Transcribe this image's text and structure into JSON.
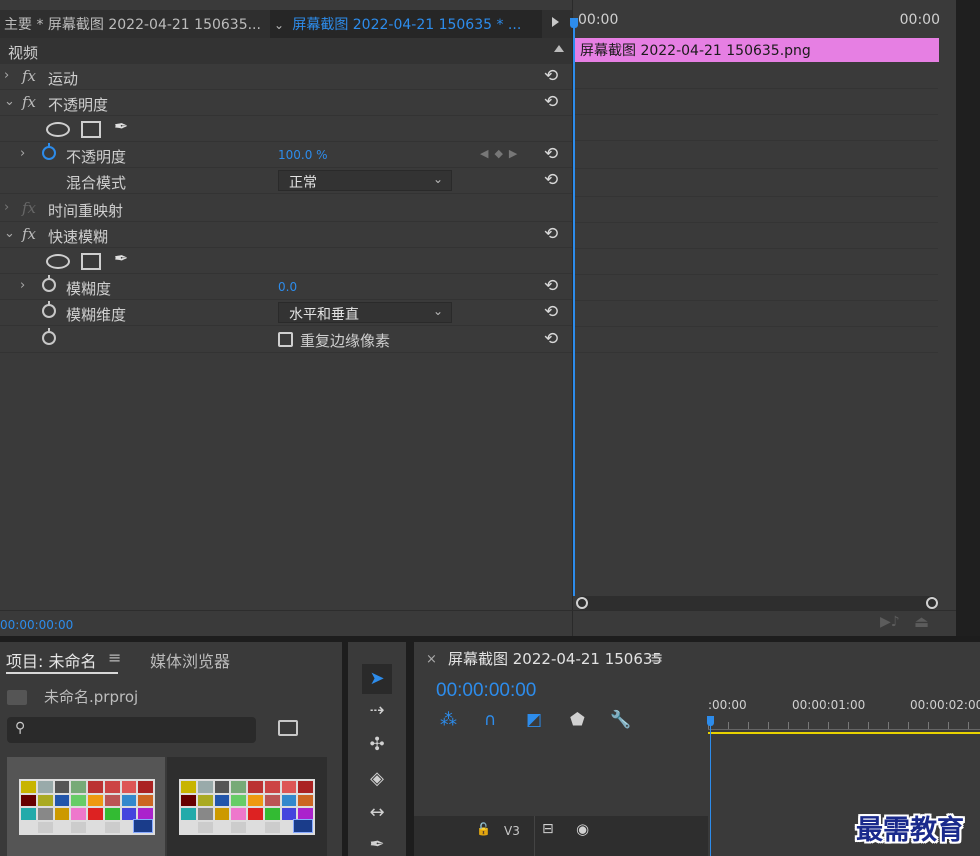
{
  "effect_controls": {
    "master_tab": "主要 * 屏幕截图 2022-04-21 150635...",
    "clip_tab": "屏幕截图 2022-04-21 150635 * ...",
    "section": "视频",
    "rows": {
      "motion": "运动",
      "opacity_group": "不透明度",
      "opacity_param": "不透明度",
      "opacity_value": "100.0 %",
      "blend_mode": "混合模式",
      "blend_value": "正常",
      "time_remap": "时间重映射",
      "fast_blur": "快速模糊",
      "blurriness": "模糊度",
      "blurriness_value": "0.0",
      "blur_dimensions": "模糊维度",
      "blur_dimensions_value": "水平和垂直",
      "repeat_edge_label": "重复边缘像素"
    },
    "timecode": "00:00:00:00",
    "timeline": {
      "ruler_start": "00:00",
      "ruler_end": "00:00",
      "clip_label": "屏幕截图 2022-04-21  150635.png",
      "clip_color": "#e67fe3"
    }
  },
  "project": {
    "tab_label": "项目: 未命名",
    "menu_glyph": "≡",
    "tab2_label": "媒体浏览器",
    "file_name": "未命名.prproj"
  },
  "timeline_panel": {
    "close_glyph": "×",
    "sequence_name": "屏幕截图 2022-04-21 150635",
    "menu_glyph": "≡",
    "timecode": "00:00:00:00",
    "ruler_labels": [
      ":00:00",
      "00:00:01:00",
      "00:00:02:00"
    ],
    "track_name": "V3"
  },
  "watermark": "最需教育",
  "colors": {
    "accent": "#2d8ceb",
    "clip": "#e67fe3",
    "work_area": "#e8d200"
  }
}
